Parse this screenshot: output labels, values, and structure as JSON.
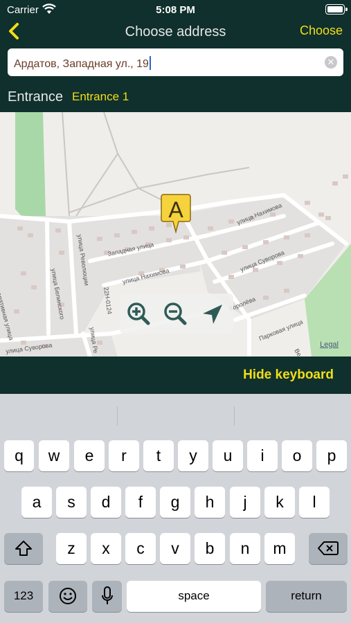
{
  "status": {
    "carrier": "Carrier",
    "time": "5:08 PM"
  },
  "header": {
    "title": "Choose address",
    "choose_label": "Choose"
  },
  "address": {
    "value": "Ардатов, Западная ул., 19"
  },
  "entrance": {
    "label": "Entrance",
    "value": "Entrance 1"
  },
  "map": {
    "marker_letter": "A",
    "legal": "Legal",
    "street_labels": [
      "Западная улица",
      "улица Нахимова",
      "улица Нахимова",
      "улица Суворова",
      "Кооперативная улица",
      "улица Белинского",
      "улица Революции",
      "22Н-0124",
      "улица Ре",
      "улица Суворова",
      "Королёва",
      "Парковая улица",
      "Ве"
    ]
  },
  "hide_keyboard_label": "Hide keyboard",
  "keyboard": {
    "row1": [
      "q",
      "w",
      "e",
      "r",
      "t",
      "y",
      "u",
      "i",
      "o",
      "p"
    ],
    "row2": [
      "a",
      "s",
      "d",
      "f",
      "g",
      "h",
      "j",
      "k",
      "l"
    ],
    "row3": [
      "z",
      "x",
      "c",
      "v",
      "b",
      "n",
      "m"
    ],
    "numbers_label": "123",
    "space_label": "space",
    "return_label": "return"
  },
  "colors": {
    "accent": "#f2de17",
    "bar": "#0f302c",
    "map_icon": "#2f5b57"
  }
}
